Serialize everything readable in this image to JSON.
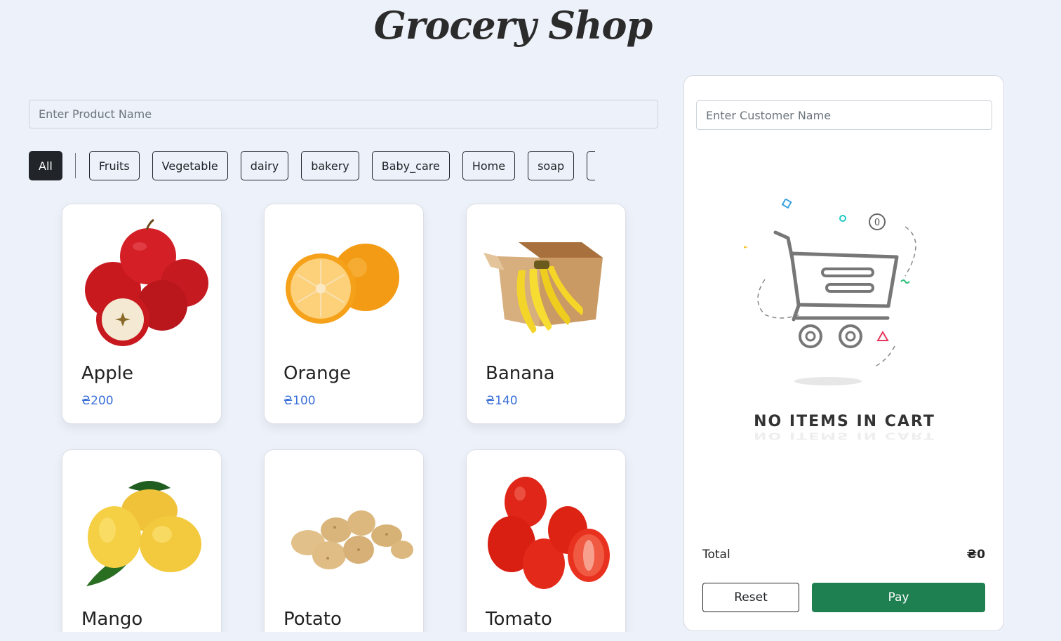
{
  "header": {
    "title": "Grocery Shop"
  },
  "search": {
    "placeholder": "Enter Product Name"
  },
  "categories": {
    "all_label": "All",
    "items": [
      "Fruits",
      "Vegetable",
      "dairy",
      "bakery",
      "Baby_care",
      "Home",
      "soap"
    ]
  },
  "products": [
    {
      "name": "Apple",
      "price": "₴200",
      "icon": "apple-image"
    },
    {
      "name": "Orange",
      "price": "₴100",
      "icon": "orange-image"
    },
    {
      "name": "Banana",
      "price": "₴140",
      "icon": "banana-image"
    },
    {
      "name": "Mango",
      "icon": "mango-image"
    },
    {
      "name": "Potato",
      "icon": "potato-image"
    },
    {
      "name": "Tomato",
      "icon": "tomato-image"
    }
  ],
  "cart": {
    "customer_placeholder": "Enter Customer Name",
    "empty_message": "NO ITEMS IN CART",
    "empty_icon": "empty-cart-illustration",
    "total_label": "Total",
    "total_value": "₴0",
    "reset_label": "Reset",
    "pay_label": "Pay"
  },
  "colors": {
    "background": "#edf1f9",
    "price": "#3a6fd8",
    "pay_button": "#1e8050",
    "active_category": "#212529"
  }
}
